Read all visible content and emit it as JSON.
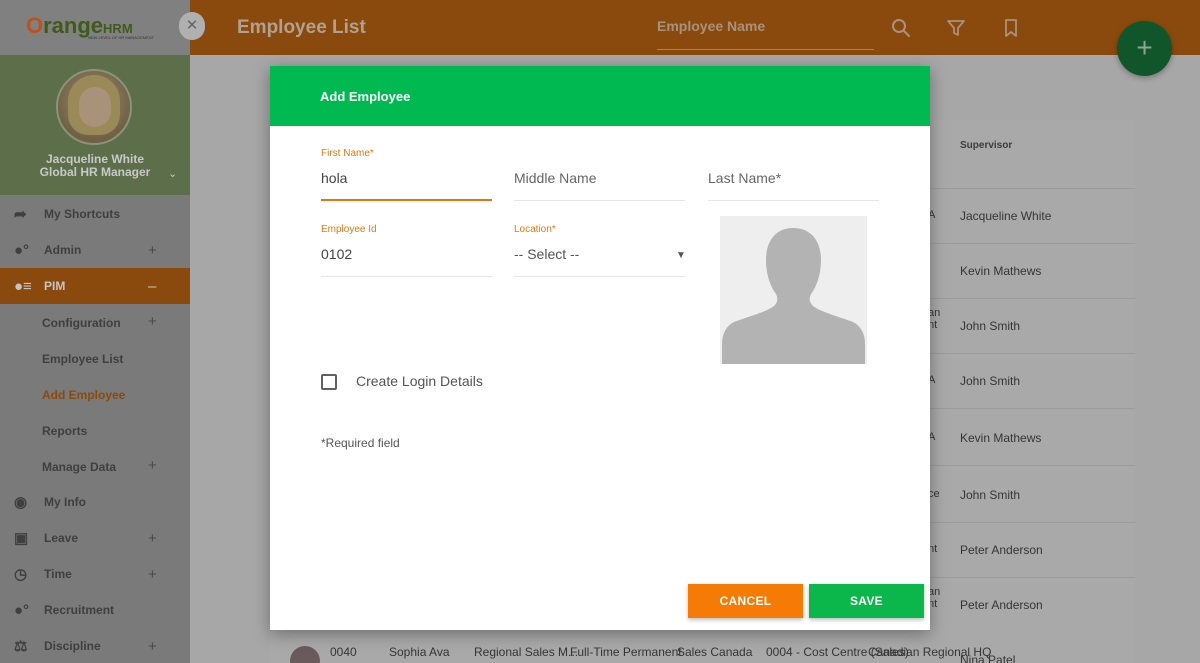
{
  "app": {
    "logo_prefix": "O",
    "logo_name": "range",
    "logo_suffix": "HRM",
    "logo_tagline": "NEW LEVEL OF HR MANAGEMENT"
  },
  "header": {
    "title": "Employee List",
    "search_placeholder": "Employee Name"
  },
  "profile": {
    "name": "Jacqueline White",
    "role": "Global HR Manager"
  },
  "sidebar": {
    "items": [
      {
        "label": "My Shortcuts",
        "icon": "share-arrow-icon"
      },
      {
        "label": "Admin",
        "icon": "admin-users-icon"
      },
      {
        "label": "PIM",
        "icon": "pim-card-icon"
      },
      {
        "label": "My Info",
        "icon": "user-circle-icon"
      },
      {
        "label": "Leave",
        "icon": "briefcase-icon"
      },
      {
        "label": "Time",
        "icon": "clock-icon"
      },
      {
        "label": "Recruitment",
        "icon": "recruitment-icon"
      },
      {
        "label": "Discipline",
        "icon": "discipline-icon"
      }
    ],
    "pim_subitems": [
      "Configuration",
      "Employee List",
      "Add Employee",
      "Reports",
      "Manage Data"
    ]
  },
  "background_table": {
    "supervisor_header": "Supervisor",
    "supervisors": [
      "Jacqueline White",
      "Kevin Mathews",
      "John Smith",
      "John Smith",
      "Kevin Mathews",
      "John Smith",
      "Peter Anderson",
      "Peter Anderson",
      "Nina Patel"
    ],
    "fragments": [
      "A",
      "an",
      "nt",
      "A",
      "A",
      "ce",
      "nt",
      "an",
      "nt"
    ],
    "last_row": [
      "0040",
      "Sophia Ava",
      "Regional Sales M...",
      "Full-Time Permanent",
      "Sales Canada",
      "0004 - Cost Centre (Sales)",
      "Canadian Regional HQ"
    ]
  },
  "modal": {
    "title": "Add Employee",
    "first_name_label": "First Name",
    "first_name_value": "hola",
    "middle_name_placeholder": "Middle Name",
    "last_name_placeholder": "Last Name",
    "employee_id_label": "Employee Id",
    "employee_id_value": "0102",
    "location_label": "Location",
    "location_value": "-- Select --",
    "required_mark": "*",
    "create_login_label": "Create Login Details",
    "required_note": "Required field",
    "cancel_label": "CANCEL",
    "save_label": "SAVE"
  },
  "colors": {
    "brand_orange": "#f57b06",
    "modal_green": "#00b951",
    "save_green": "#0bb64b"
  }
}
